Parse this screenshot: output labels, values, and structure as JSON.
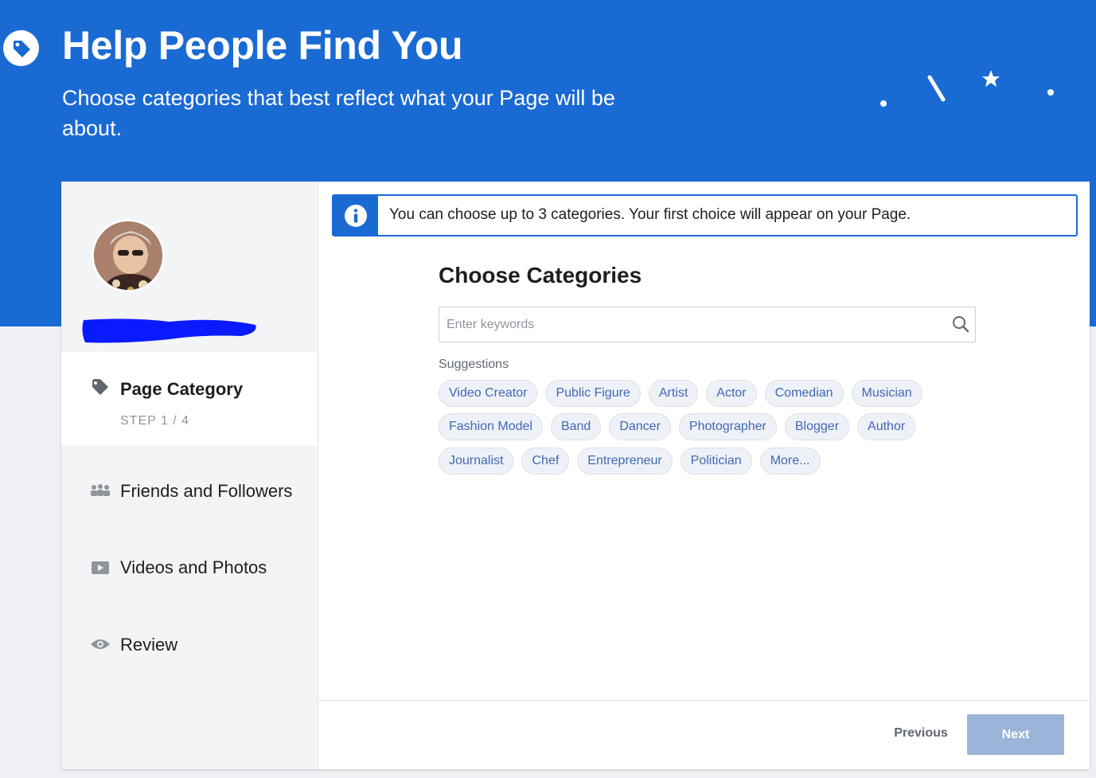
{
  "header": {
    "title": "Help People Find You",
    "subtitle": "Choose categories that best reflect what your Page will be about."
  },
  "sidebar": {
    "steps": [
      {
        "label": "Page Category",
        "sub": "STEP 1 / 4",
        "icon": "tag-icon",
        "active": true
      },
      {
        "label": "Friends and Followers",
        "icon": "people-icon"
      },
      {
        "label": "Videos and Photos",
        "icon": "video-icon"
      },
      {
        "label": "Review",
        "icon": "eye-icon"
      }
    ]
  },
  "info": {
    "text": "You can choose up to 3 categories. Your first choice will appear on your Page."
  },
  "main": {
    "title": "Choose Categories",
    "search_placeholder": "Enter keywords",
    "suggestions_label": "Suggestions",
    "suggestions": [
      [
        "Video Creator",
        "Public Figure",
        "Artist",
        "Actor",
        "Comedian",
        "Musician"
      ],
      [
        "Fashion Model",
        "Band",
        "Dancer",
        "Photographer",
        "Blogger",
        "Author"
      ],
      [
        "Journalist",
        "Chef",
        "Entrepreneur",
        "Politician",
        "More..."
      ]
    ]
  },
  "footer": {
    "previous_label": "Previous",
    "next_label": "Next"
  },
  "colors": {
    "brand_blue": "#1a6ad4",
    "chip_text": "#4267b2",
    "next_disabled": "#9cb4d8"
  }
}
